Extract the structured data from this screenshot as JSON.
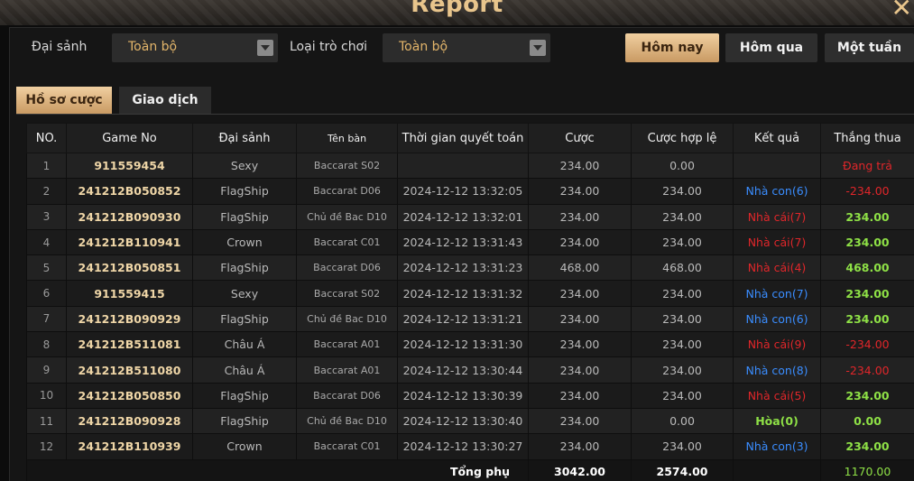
{
  "window": {
    "title": "Report"
  },
  "filters": {
    "hall_label": "Đại sảnh",
    "hall_value": "Toàn bộ",
    "game_type_label": "Loại trò chơi",
    "game_type_value": "Toàn bộ"
  },
  "date_buttons": {
    "today": "Hôm nay",
    "yesterday": "Hôm qua",
    "week": "Một tuần"
  },
  "tabs": {
    "bets": "Hồ sơ cược",
    "transactions": "Giao dịch"
  },
  "table": {
    "headers": [
      "NO.",
      "Game No",
      "Đại sảnh",
      "Tên bàn",
      "Thời gian quyết toán",
      "Cược",
      "Cược hợp lệ",
      "Kết quả",
      "Thắng thua"
    ],
    "rows": [
      {
        "no": "1",
        "game_no": "911559454",
        "hall": "Sexy",
        "table": "Baccarat S02",
        "time": "",
        "bet": "234.00",
        "valid": "0.00",
        "result": "",
        "result_type": "",
        "wl": "Đang trả",
        "wl_type": "pend"
      },
      {
        "no": "2",
        "game_no": "241212B050852",
        "hall": "FlagShip",
        "table": "Baccarat D06",
        "time": "2024-12-12 13:32:05",
        "bet": "234.00",
        "valid": "234.00",
        "result": "Nhà con(6)",
        "result_type": "player",
        "wl": "-234.00",
        "wl_type": "neg"
      },
      {
        "no": "3",
        "game_no": "241212B090930",
        "hall": "FlagShip",
        "table": "Chủ đề Bac D10",
        "time": "2024-12-12 13:32:01",
        "bet": "234.00",
        "valid": "234.00",
        "result": "Nhà cái(7)",
        "result_type": "banker",
        "wl": "234.00",
        "wl_type": "pos"
      },
      {
        "no": "4",
        "game_no": "241212B110941",
        "hall": "Crown",
        "table": "Baccarat C01",
        "time": "2024-12-12 13:31:43",
        "bet": "234.00",
        "valid": "234.00",
        "result": "Nhà cái(7)",
        "result_type": "banker",
        "wl": "234.00",
        "wl_type": "pos"
      },
      {
        "no": "5",
        "game_no": "241212B050851",
        "hall": "FlagShip",
        "table": "Baccarat D06",
        "time": "2024-12-12 13:31:23",
        "bet": "468.00",
        "valid": "468.00",
        "result": "Nhà cái(4)",
        "result_type": "banker",
        "wl": "468.00",
        "wl_type": "pos"
      },
      {
        "no": "6",
        "game_no": "911559415",
        "hall": "Sexy",
        "table": "Baccarat S02",
        "time": "2024-12-12 13:31:32",
        "bet": "234.00",
        "valid": "234.00",
        "result": "Nhà con(7)",
        "result_type": "player",
        "wl": "234.00",
        "wl_type": "pos"
      },
      {
        "no": "7",
        "game_no": "241212B090929",
        "hall": "FlagShip",
        "table": "Chủ đề Bac D10",
        "time": "2024-12-12 13:31:21",
        "bet": "234.00",
        "valid": "234.00",
        "result": "Nhà con(6)",
        "result_type": "player",
        "wl": "234.00",
        "wl_type": "pos"
      },
      {
        "no": "8",
        "game_no": "241212B511081",
        "hall": "Châu Á",
        "table": "Baccarat A01",
        "time": "2024-12-12 13:31:30",
        "bet": "234.00",
        "valid": "234.00",
        "result": "Nhà cái(9)",
        "result_type": "banker",
        "wl": "-234.00",
        "wl_type": "neg"
      },
      {
        "no": "9",
        "game_no": "241212B511080",
        "hall": "Châu Á",
        "table": "Baccarat A01",
        "time": "2024-12-12 13:30:44",
        "bet": "234.00",
        "valid": "234.00",
        "result": "Nhà con(8)",
        "result_type": "player",
        "wl": "-234.00",
        "wl_type": "neg"
      },
      {
        "no": "10",
        "game_no": "241212B050850",
        "hall": "FlagShip",
        "table": "Baccarat D06",
        "time": "2024-12-12 13:30:39",
        "bet": "234.00",
        "valid": "234.00",
        "result": "Nhà cái(5)",
        "result_type": "banker",
        "wl": "234.00",
        "wl_type": "pos"
      },
      {
        "no": "11",
        "game_no": "241212B090928",
        "hall": "FlagShip",
        "table": "Chủ đề Bac D10",
        "time": "2024-12-12 13:30:40",
        "bet": "234.00",
        "valid": "0.00",
        "result": "Hòa(0)",
        "result_type": "tie",
        "wl": "0.00",
        "wl_type": "pos"
      },
      {
        "no": "12",
        "game_no": "241212B110939",
        "hall": "Crown",
        "table": "Baccarat C01",
        "time": "2024-12-12 13:30:27",
        "bet": "234.00",
        "valid": "234.00",
        "result": "Nhà con(3)",
        "result_type": "player",
        "wl": "234.00",
        "wl_type": "pos"
      }
    ],
    "totals": {
      "label": "Tổng phụ",
      "bet": "3042.00",
      "valid": "2574.00",
      "wl": "1170.00"
    }
  },
  "colors": {
    "accent": "#e3b56a",
    "player": "#3a8dff",
    "banker": "#e0262a",
    "win": "#8ee046"
  }
}
